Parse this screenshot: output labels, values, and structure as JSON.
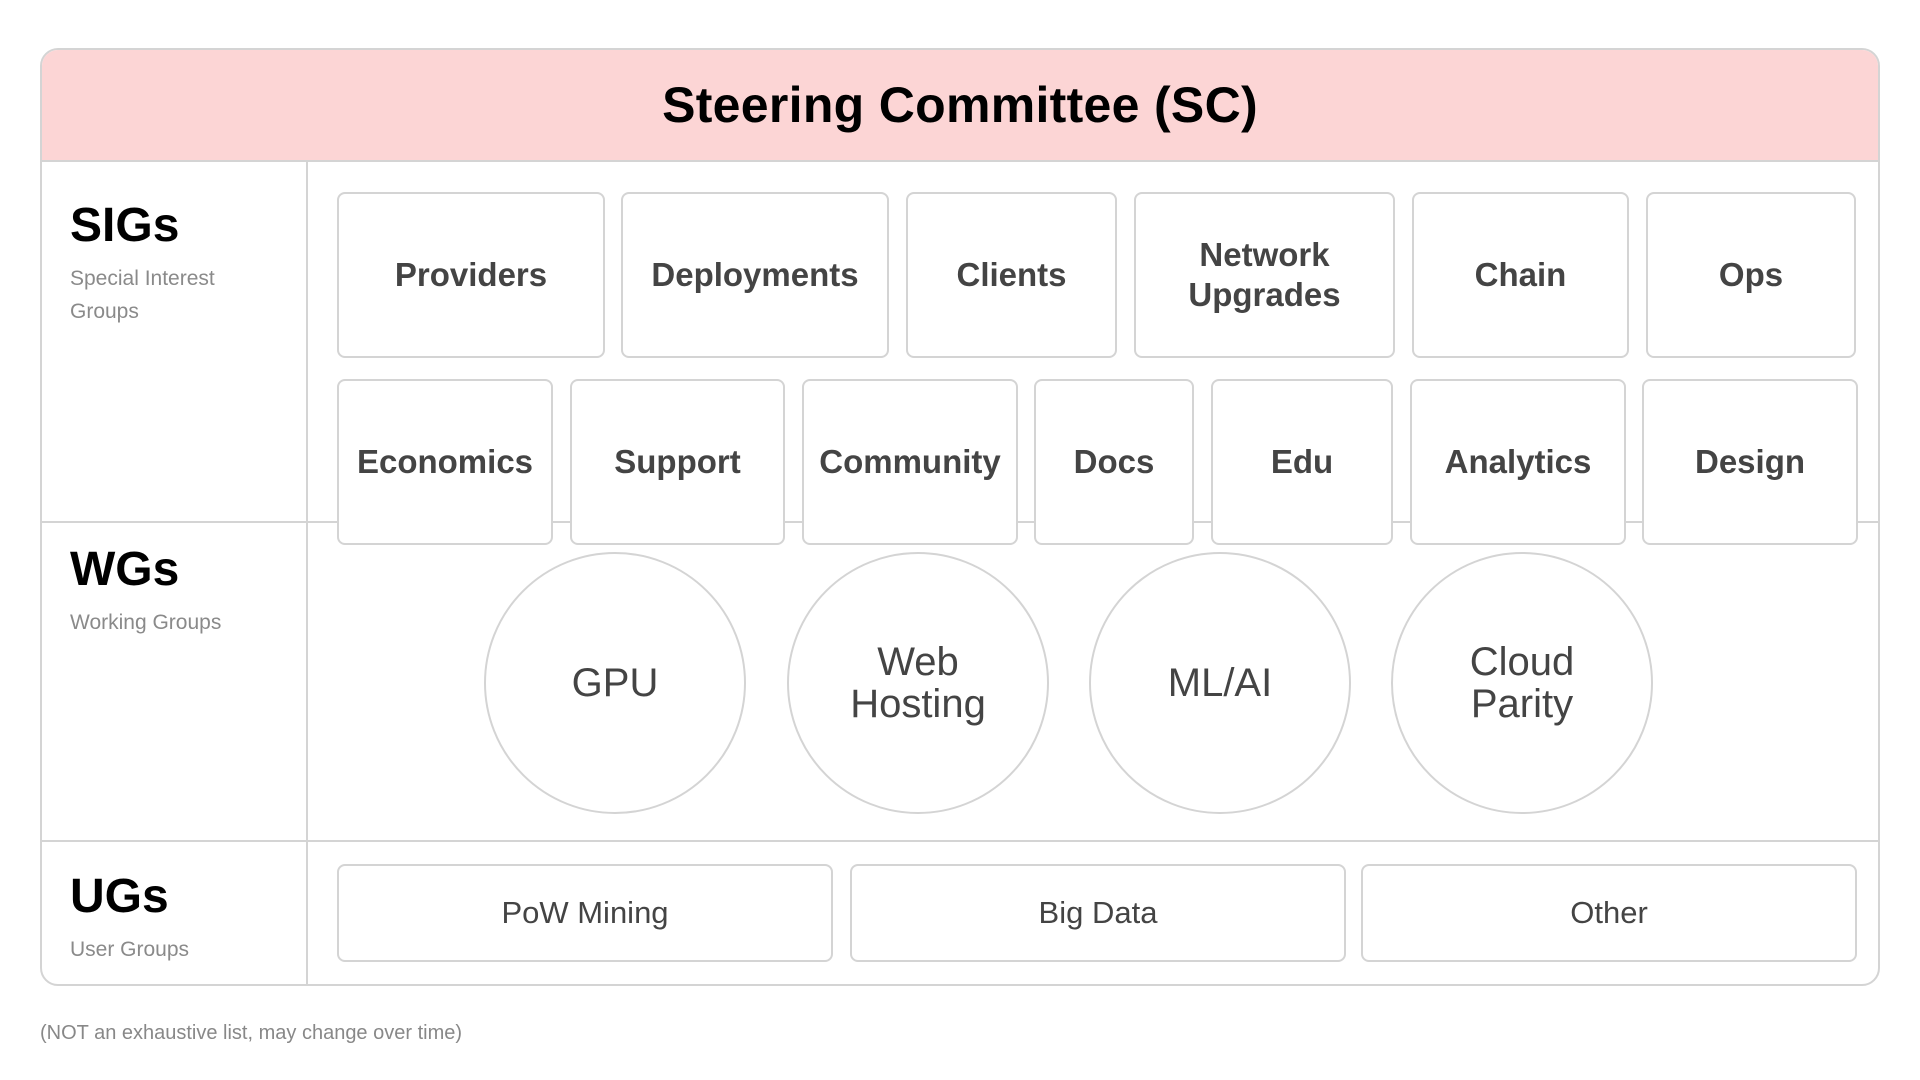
{
  "header": {
    "title": "Steering Committee (SC)",
    "background": "#fcd5d5"
  },
  "sections": {
    "sigs": {
      "title": "SIGs",
      "subtitle": "Special Interest Groups",
      "row1": [
        "Providers",
        "Deployments",
        "Clients",
        "Network Upgrades",
        "Chain",
        "Ops"
      ],
      "row2": [
        "Economics",
        "Support",
        "Community",
        "Docs",
        "Edu",
        "Analytics",
        "Design"
      ]
    },
    "wgs": {
      "title": "WGs",
      "subtitle": "Working Groups",
      "items": [
        "GPU",
        "Web Hosting",
        "ML/AI",
        "Cloud Parity"
      ]
    },
    "ugs": {
      "title": "UGs",
      "subtitle": "User Groups",
      "items": [
        "PoW Mining",
        "Big Data",
        "Other"
      ]
    }
  },
  "footnote": "(NOT an exhaustive list, may change over time)"
}
